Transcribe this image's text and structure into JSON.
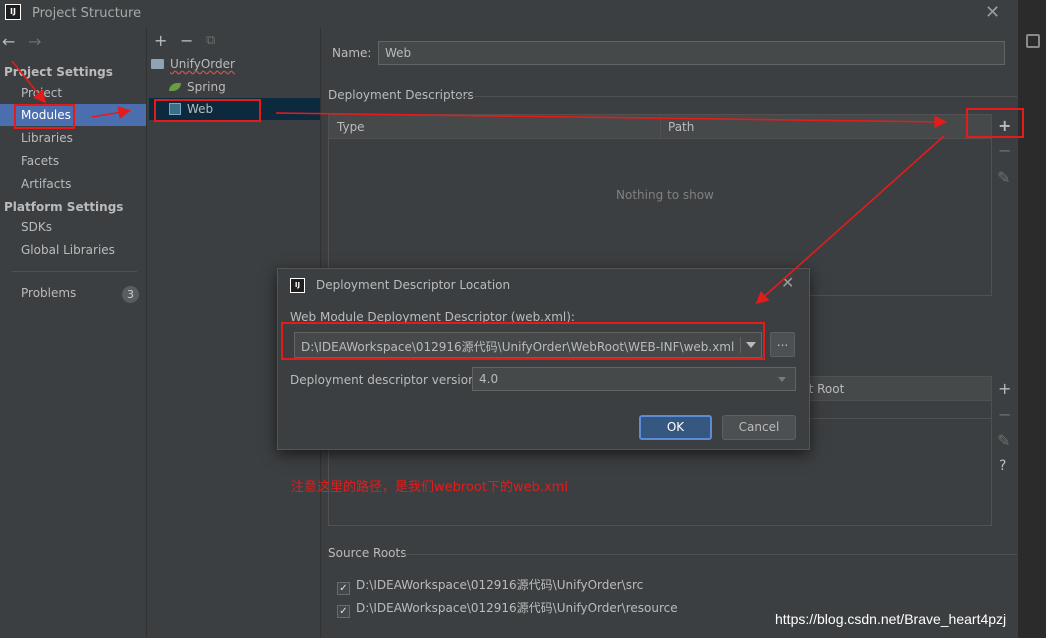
{
  "window": {
    "title": "Project Structure",
    "logo": "IJ"
  },
  "nav": {
    "sections": [
      {
        "title": "Project Settings",
        "items": [
          "Project",
          "Modules",
          "Libraries",
          "Facets",
          "Artifacts"
        ]
      },
      {
        "title": "Platform Settings",
        "items": [
          "SDKs",
          "Global Libraries"
        ]
      }
    ],
    "selected": "Modules",
    "problems_label": "Problems",
    "problems_count": "3"
  },
  "tree": {
    "items": [
      {
        "label": "UnifyOrder",
        "icon": "folder-icon"
      },
      {
        "label": "Spring",
        "icon": "spring-leaf-icon"
      },
      {
        "label": "Web",
        "icon": "web-module-icon"
      }
    ]
  },
  "module": {
    "name_label": "Name:",
    "name_value": "Web",
    "descriptors_title": "Deployment Descriptors",
    "col_type": "Type",
    "col_path": "Path",
    "empty_text": "Nothing to show",
    "root_col_fragment": "nt Root",
    "source_roots_title": "Source Roots",
    "source_roots": [
      "D:\\IDEAWorkspace\\012916源代码\\UnifyOrder\\src",
      "D:\\IDEAWorkspace\\012916源代码\\UnifyOrder\\resource"
    ]
  },
  "dialog": {
    "title": "Deployment Descriptor Location",
    "path_label": "Web Module Deployment Descriptor (web.xml):",
    "path_value": "D:\\IDEAWorkspace\\012916源代码\\UnifyOrder\\WebRoot\\WEB-INF\\web.xml",
    "browse_label": "...",
    "version_label": "Deployment descriptor version",
    "version_value": "4.0",
    "ok_label": "OK",
    "cancel_label": "Cancel"
  },
  "annotation": {
    "note": "注意这里的路径，是我们webroot下的web.xml",
    "color": "#e41b1b"
  },
  "watermark": "https://blog.csdn.net/Brave_heart4pzj"
}
